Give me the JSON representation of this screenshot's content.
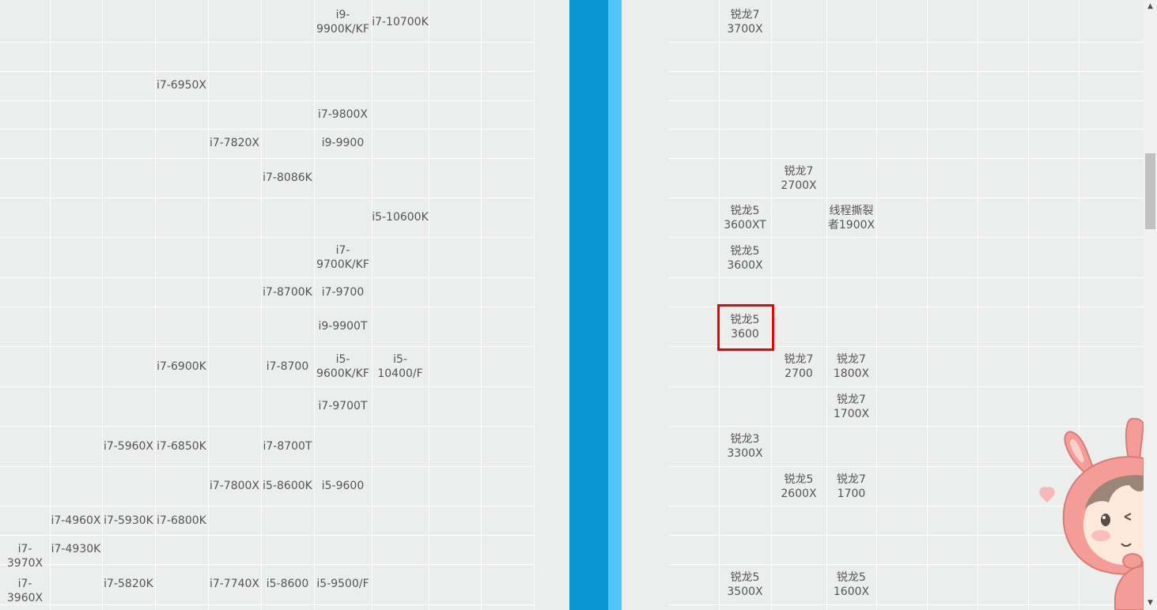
{
  "left_table": {
    "cells": [
      {
        "text": "i9-\n9900K/KF"
      },
      {
        "text": "i7-10700K"
      },
      {
        "text": "i7-6950X"
      },
      {
        "text": "i7-9800X"
      },
      {
        "text": "i7-7820X"
      },
      {
        "text": "i9-9900"
      },
      {
        "text": "i7-8086K"
      },
      {
        "text": "i5-10600K"
      },
      {
        "text": "i7-\n9700K/KF"
      },
      {
        "text": "i7-8700K"
      },
      {
        "text": "i7-9700"
      },
      {
        "text": "i9-9900T"
      },
      {
        "text": "i7-6900K"
      },
      {
        "text": "i7-8700"
      },
      {
        "text": "i5-\n9600K/KF"
      },
      {
        "text": "i5-\n10400/F"
      },
      {
        "text": "i7-9700T"
      },
      {
        "text": "i7-5960X"
      },
      {
        "text": "i7-6850K"
      },
      {
        "text": "i7-8700T"
      },
      {
        "text": "i7-7800X"
      },
      {
        "text": "i5-8600K"
      },
      {
        "text": "i5-9600"
      },
      {
        "text": "i7-4960X"
      },
      {
        "text": "i7-5930K"
      },
      {
        "text": "i7-6800K"
      },
      {
        "text": "i7-3970X"
      },
      {
        "text": "i7-4930K"
      },
      {
        "text": "i7-3960X"
      },
      {
        "text": "i7-5820K"
      },
      {
        "text": "i7-7740X"
      },
      {
        "text": "i5-8600"
      },
      {
        "text": "i5-9500/F"
      }
    ]
  },
  "right_table": {
    "cells": [
      {
        "text": "锐龙7\n3700X"
      },
      {
        "text": "锐龙7\n2700X"
      },
      {
        "text": "锐龙5\n3600XT"
      },
      {
        "text": "线程撕裂\n者1900X"
      },
      {
        "text": "锐龙5\n3600X"
      },
      {
        "text": "锐龙5\n3600"
      },
      {
        "text": "锐龙7\n2700"
      },
      {
        "text": "锐龙7\n1800X"
      },
      {
        "text": "锐龙7\n1700X"
      },
      {
        "text": "锐龙3\n3300X"
      },
      {
        "text": "锐龙5\n2600X"
      },
      {
        "text": "锐龙7\n1700"
      },
      {
        "text": "锐龙5\n3500X"
      },
      {
        "text": "锐龙5\n1600X"
      }
    ],
    "highlighted": "锐龙5\n3600"
  },
  "colors": {
    "background": "#eceeed",
    "divider_dark": "#0a94d1",
    "divider_light": "#4fc6f8",
    "highlight": "#ea0000"
  },
  "icons": {
    "scroll_up": "scroll-up-arrow-icon",
    "scroll_down": "scroll-down-arrow-icon",
    "mascot": "bunny-mascot-icon",
    "heart": "heart-icon"
  }
}
